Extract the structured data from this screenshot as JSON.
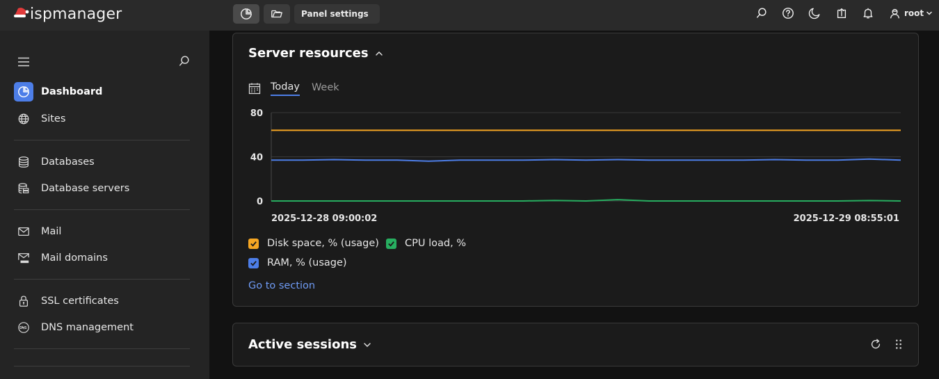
{
  "topbar": {
    "logo_text": "ispmanager",
    "panel_settings_label": "Panel settings",
    "user_name": "root"
  },
  "sidebar": {
    "items": [
      {
        "label": "Dashboard",
        "icon": "dashboard-icon",
        "active": true
      },
      {
        "label": "Sites",
        "icon": "globe-icon"
      },
      {
        "label": "Databases",
        "icon": "database-icon"
      },
      {
        "label": "Database servers",
        "icon": "database-server-icon"
      },
      {
        "label": "Mail",
        "icon": "mail-icon"
      },
      {
        "label": "Mail domains",
        "icon": "mail-domain-icon"
      },
      {
        "label": "SSL certificates",
        "icon": "lock-icon"
      },
      {
        "label": "DNS management",
        "icon": "dns-icon"
      }
    ]
  },
  "server_resources": {
    "title": "Server resources",
    "tabs": [
      "Today",
      "Week"
    ],
    "active_tab": "Today",
    "go_to_section": "Go to section"
  },
  "active_sessions": {
    "title": "Active sessions"
  },
  "colors": {
    "accent": "#4d7ee8",
    "disk": "#f5a623",
    "cpu": "#27ae60",
    "ram": "#4d7ee8"
  },
  "chart_data": {
    "type": "line",
    "ylim": [
      0,
      80
    ],
    "y_ticks": [
      "80",
      "40",
      "0"
    ],
    "x_labels": [
      "2025-12-28 09:00:02",
      "2025-12-29 08:55:01"
    ],
    "series": [
      {
        "name": "Disk space, % (usage)",
        "color": "#f5a623",
        "checked": true,
        "values": [
          64,
          64,
          64,
          64,
          64,
          64,
          64,
          64,
          64,
          64,
          64,
          64,
          64,
          64,
          64,
          64,
          64,
          64,
          64,
          64,
          64
        ]
      },
      {
        "name": "CPU load, %",
        "color": "#27ae60",
        "checked": true,
        "values": [
          0,
          0,
          0,
          0,
          0,
          0,
          0,
          0,
          0,
          0.5,
          0,
          1.2,
          0,
          0,
          0,
          0,
          0,
          0,
          0,
          0.4,
          0
        ]
      },
      {
        "name": "RAM, % (usage)",
        "color": "#4d7ee8",
        "checked": true,
        "values": [
          37,
          37,
          37.5,
          37,
          37,
          36,
          37,
          37,
          37,
          37.5,
          37,
          37.5,
          37,
          37,
          37,
          37,
          37.5,
          37,
          37,
          38,
          37
        ]
      }
    ]
  }
}
